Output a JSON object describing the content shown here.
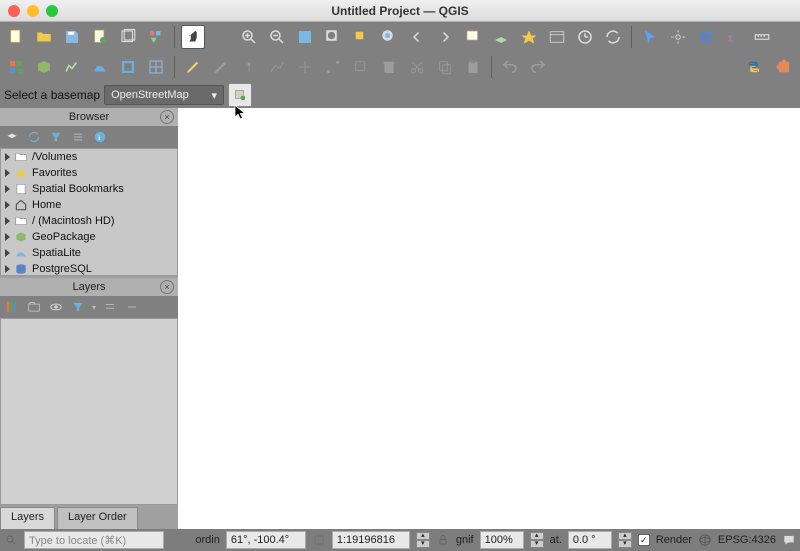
{
  "title": "Untitled Project — QGIS",
  "basemap": {
    "label": "Select a basemap",
    "selected": "OpenStreetMap"
  },
  "browser": {
    "title": "Browser",
    "items": [
      {
        "icon": "folder",
        "label": "/Volumes"
      },
      {
        "icon": "star",
        "label": "Favorites"
      },
      {
        "icon": "bookmark",
        "label": "Spatial Bookmarks"
      },
      {
        "icon": "home",
        "label": "Home"
      },
      {
        "icon": "folder",
        "label": "/ (Macintosh HD)"
      },
      {
        "icon": "geopackage",
        "label": "GeoPackage"
      },
      {
        "icon": "spatialite",
        "label": "SpatiaLite"
      },
      {
        "icon": "postgres",
        "label": "PostgreSQL"
      }
    ]
  },
  "layers": {
    "title": "Layers"
  },
  "tabs": {
    "layers": "Layers",
    "layerOrder": "Layer Order"
  },
  "status": {
    "locator_placeholder": "Type to locate (⌘K)",
    "coord_label": "ordin",
    "coord_value": "61°, -100.4°",
    "scale_label": "",
    "scale_value": "1:19196816",
    "magnifier_label": "gnif",
    "magnifier_value": "100%",
    "rotation_label": "at.",
    "rotation_value": "0.0 °",
    "render_label": "Render",
    "crs": "EPSG:4326"
  }
}
